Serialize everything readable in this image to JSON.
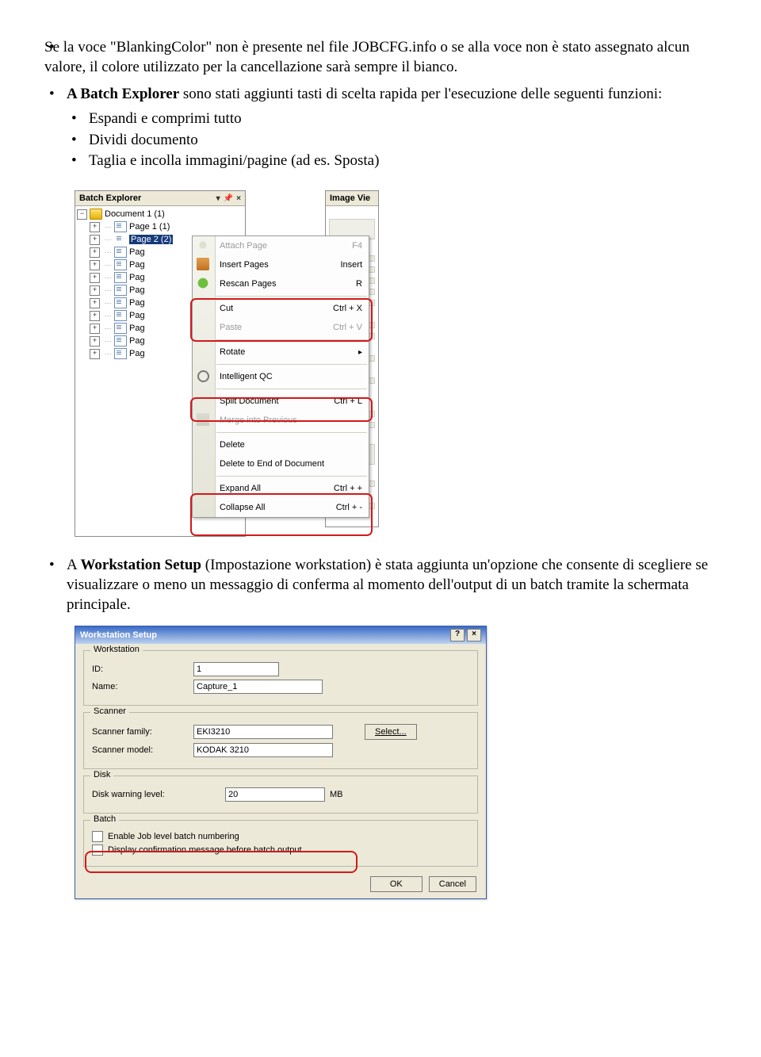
{
  "text": {
    "p1": "Se la voce \"BlankingColor\" non è presente nel file JOBCFG.info o se alla voce non è stato assegnato alcun valore, il colore utilizzato per la cancellazione sarà sempre il bianco.",
    "batch_lead_b": "A Batch Explorer",
    "batch_lead_r": " sono stati aggiunti tasti di scelta rapida per l'esecuzione delle seguenti funzioni:",
    "sub1": "Espandi e comprimi tutto",
    "sub2": "Dividi documento",
    "sub3": "Taglia e incolla immagini/pagine (ad es. Sposta)",
    "ws_lead_b1": "A ",
    "ws_lead_b2": "Workstation Setup",
    "ws_lead_r": " (Impostazione workstation) è stata aggiunta un'opzione che consente di scegliere se visualizzare o meno un messaggio di conferma al momento dell'output di un batch tramite la schermata principale."
  },
  "be": {
    "panel_title": "Batch Explorer",
    "iv_title": "Image Vie",
    "doc": "Document 1 (1)",
    "page1": "Page 1 (1)",
    "page2": "Page 2 (2)",
    "pag": "Pag"
  },
  "ctx": {
    "attach": "Attach Page",
    "attach_sc": "F4",
    "insert": "Insert Pages",
    "insert_sc": "Insert",
    "rescan": "Rescan Pages",
    "rescan_sc": "R",
    "cut": "Cut",
    "cut_sc": "Ctrl + X",
    "paste": "Paste",
    "paste_sc": "Ctrl + V",
    "rotate": "Rotate",
    "iqc": "Intelligent QC",
    "split": "Split Document",
    "split_sc": "Ctrl + L",
    "merge": "Merge into Previous",
    "delete": "Delete",
    "deleteend": "Delete to End of Document",
    "expand": "Expand All",
    "expand_sc": "Ctrl + +",
    "collapse": "Collapse All",
    "collapse_sc": "Ctrl + -"
  },
  "ws": {
    "title": "Workstation Setup",
    "help": "?",
    "close": "×",
    "g_workstation": "Workstation",
    "l_id": "ID:",
    "v_id": "1",
    "l_name": "Name:",
    "v_name": "Capture_1",
    "g_scanner": "Scanner",
    "l_sf": "Scanner family:",
    "v_sf": "EKI3210",
    "l_sm": "Scanner model:",
    "v_sm": "KODAK 3210",
    "b_select": "Select...",
    "g_disk": "Disk",
    "l_dw": "Disk warning level:",
    "v_dw": "20",
    "unit": "MB",
    "g_batch": "Batch",
    "c1": "Enable Job level batch numbering",
    "c2": "Display confirmation message before batch output",
    "ok": "OK",
    "cancel": "Cancel"
  }
}
